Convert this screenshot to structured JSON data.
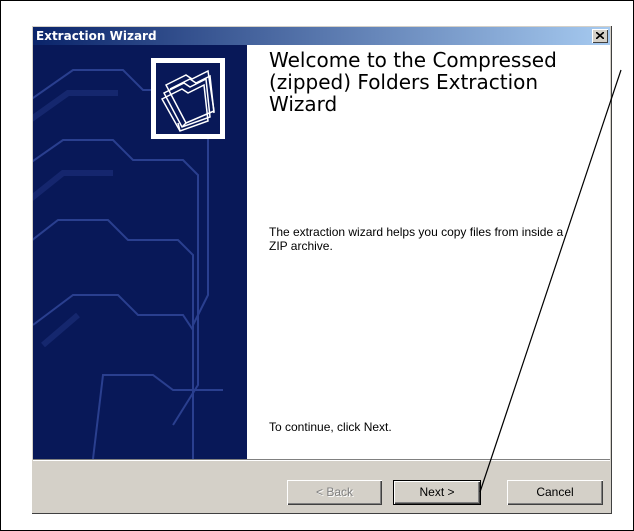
{
  "dialog": {
    "title": "Extraction Wizard"
  },
  "welcome": {
    "heading": "Welcome to the Compressed (zipped) Folders Extraction Wizard",
    "description": "The extraction wizard helps you copy files from inside a ZIP archive.",
    "continue_text": "To continue, click Next."
  },
  "buttons": {
    "back": "< Back",
    "next": "Next >",
    "cancel": "Cancel"
  },
  "icons": [
    "close-icon",
    "folders-icon"
  ],
  "colors": {
    "titlebar_start": "#0a246a",
    "titlebar_end": "#a6caf0",
    "banner": "#081858",
    "dialog_face": "#d4d0c8"
  }
}
